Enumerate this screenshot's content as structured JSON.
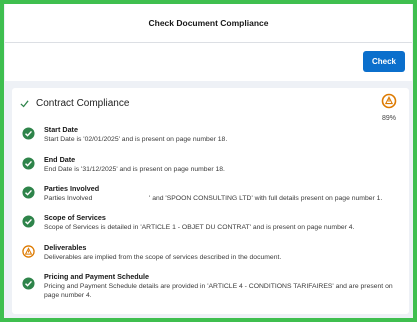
{
  "modal": {
    "title": "Check Document Compliance"
  },
  "toolbar": {
    "check_label": "Check"
  },
  "section": {
    "title": "Contract Compliance",
    "score": "89%"
  },
  "items": [
    {
      "status": "pass",
      "title": "Start Date",
      "desc": "Start Date is '02/01/2025' and is present on page number 18."
    },
    {
      "status": "pass",
      "title": "End Date",
      "desc": "End Date is '31/12/2025' and is present on page number 18."
    },
    {
      "status": "pass",
      "title": "Parties Involved",
      "desc": "Parties Involved                              ' and 'SPOON CONSULTING LTD' with full details present on page number 1."
    },
    {
      "status": "pass",
      "title": "Scope of Services",
      "desc": "Scope of Services is detailed in 'ARTICLE 1 - OBJET DU CONTRAT' and is present on page number 4."
    },
    {
      "status": "warning",
      "title": "Deliverables",
      "desc": "Deliverables are implied from the scope of services described in the document."
    },
    {
      "status": "pass",
      "title": "Pricing and Payment Schedule",
      "desc": "Pricing and Payment Schedule details are provided in 'ARTICLE 4 - CONDITIONS TARIFAIRES' and are present on page number 4."
    }
  ],
  "colors": {
    "accent": "#0b6fcc",
    "pass": "#2e844a",
    "warning": "#dd7a01",
    "frame": "#3fbf4f"
  }
}
